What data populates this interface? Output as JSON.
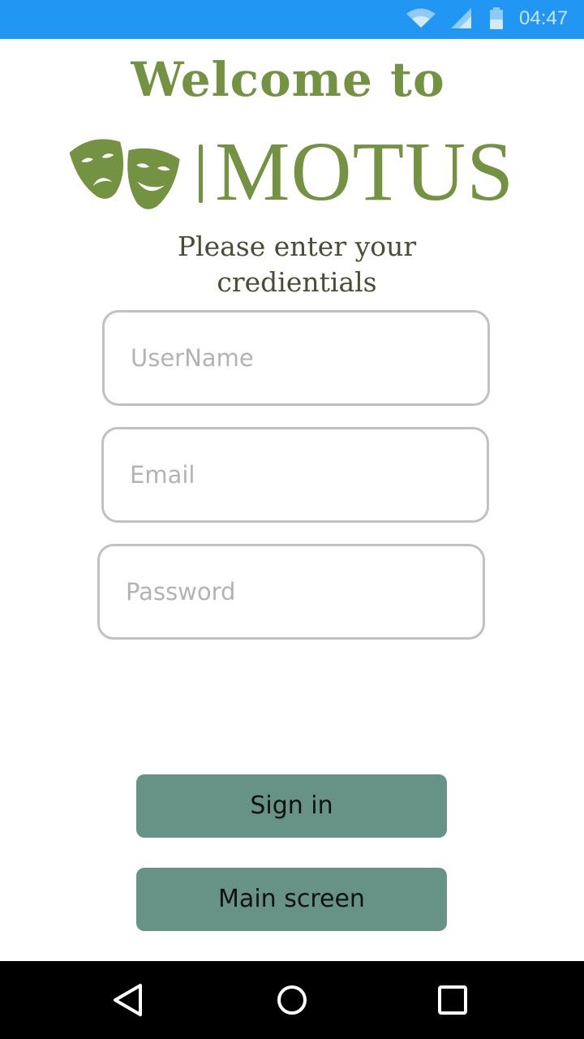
{
  "status_bar": {
    "time": "04:47",
    "icons": [
      "wifi-icon",
      "cell-signal-icon",
      "battery-icon"
    ],
    "color": "#2196f3"
  },
  "header": {
    "welcome": "Welcome to",
    "logo_text": "MOTUS",
    "subtitle": "Please enter your credientials"
  },
  "form": {
    "username_placeholder": "UserName",
    "username_value": "",
    "email_placeholder": "Email",
    "email_value": "",
    "password_placeholder": "Password",
    "password_value": ""
  },
  "buttons": {
    "sign_in": "Sign in",
    "main_screen": "Main screen"
  },
  "nav_bar": {
    "icons": [
      "back-icon",
      "home-icon",
      "recents-icon"
    ]
  },
  "colors": {
    "brand_green": "#739343",
    "button_teal": "#679386",
    "input_border": "#c1c1c1"
  }
}
